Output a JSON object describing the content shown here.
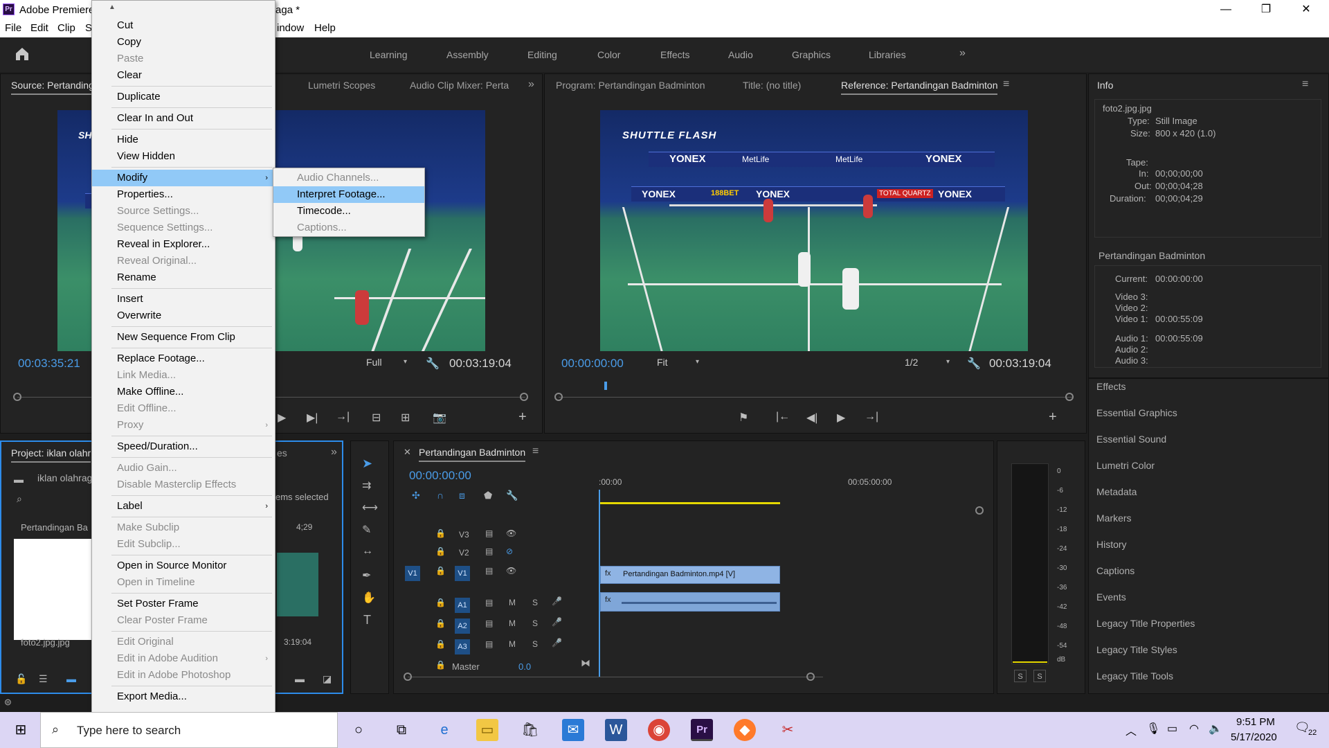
{
  "window": {
    "title_left": "Adobe Premiere",
    "title_right": "aga *",
    "minimize": "—",
    "maximize": "❐",
    "close": "✕"
  },
  "menubar": [
    "File",
    "Edit",
    "Clip",
    "S",
    "indow",
    "Help"
  ],
  "workspaces": [
    "Learning",
    "Assembly",
    "Editing",
    "Color",
    "Effects",
    "Audio",
    "Graphics",
    "Libraries"
  ],
  "source": {
    "tab": "Source: Pertanding",
    "tab2": "Lumetri Scopes",
    "tab3": "Audio Clip Mixer: Perta",
    "timecode": "00:03:35:21",
    "quality": "Full",
    "duration": "00:03:19:04",
    "overlay_label": "SH"
  },
  "program": {
    "tab": "Program: Pertandingan Badminton",
    "tab2": "Title: (no title)",
    "tab3": "Reference: Pertandingan Badminton",
    "timecode": "00:00:00:00",
    "fit": "Fit",
    "resolution": "1/2",
    "duration": "00:03:19:04",
    "overlay_label": "SHUTTLE FLASH",
    "banners": [
      "YONEX",
      "MetLife",
      "MetLife",
      "YONEX",
      "YONEX",
      "188BET",
      "YONEX",
      "TOTAL QUARTZ",
      "YONEX"
    ]
  },
  "info": {
    "tab": "Info",
    "filename": "foto2.jpg.jpg",
    "type_label": "Type:",
    "type_value": "Still Image",
    "size_label": "Size:",
    "size_value": "800 x 420 (1.0)",
    "tape_label": "Tape:",
    "in_label": "In:",
    "in_value": "00;00;00;00",
    "out_label": "Out:",
    "out_value": "00;00;04;28",
    "duration_label": "Duration:",
    "duration_value": "00;00;04;29",
    "seq_name": "Pertandingan Badminton",
    "current_label": "Current:",
    "current_value": "00:00:00:00",
    "video3": "Video 3:",
    "video2": "Video 2:",
    "video1": "Video 1:",
    "video1_value": "00:00:55:09",
    "audio1": "Audio 1:",
    "audio1_value": "00:00:55:09",
    "audio2": "Audio 2:",
    "audio3": "Audio 3:"
  },
  "right_panels": [
    "Effects",
    "Essential Graphics",
    "Essential Sound",
    "Lumetri Color",
    "Metadata",
    "Markers",
    "History",
    "Captions",
    "Events",
    "Legacy Title Properties",
    "Legacy Title Styles",
    "Legacy Title Tools"
  ],
  "project": {
    "tab": "Project: iklan olahr",
    "folder": "iklan olahrag",
    "items_selected": "ems selected",
    "item1": "Pertandingan Ba",
    "item1_dur": "4;29",
    "item2": "foto2.jpg.jpg",
    "item2_dur": "3:19:04",
    "tab_partial": "es"
  },
  "timeline": {
    "tab": "Pertandingan Badminton",
    "timecode": "00:00:00:00",
    "ruler_start": ":00:00",
    "ruler_mark": "00:05:00:00",
    "tracks_video": [
      "V3",
      "V2",
      "V1"
    ],
    "tracks_audio": [
      "A1",
      "A2",
      "A3"
    ],
    "source_patch_video": "V1",
    "master_label": "Master",
    "master_value": "0.0",
    "clip_video": "Pertandingan Badminton.mp4 [V]",
    "m": "M",
    "s": "S"
  },
  "meter": {
    "scale": [
      "0",
      "-6",
      "-12",
      "-18",
      "-24",
      "-30",
      "-36",
      "-42",
      "-48",
      "-54",
      "dB"
    ],
    "solo_left": "S",
    "solo_right": "S"
  },
  "context_menu": {
    "items": [
      {
        "label": "Cut",
        "disabled": false
      },
      {
        "label": "Copy",
        "disabled": false
      },
      {
        "label": "Paste",
        "disabled": true
      },
      {
        "label": "Clear",
        "disabled": false
      },
      {
        "label": "Duplicate",
        "disabled": false
      },
      {
        "label": "Clear In and Out",
        "disabled": false
      },
      {
        "label": "Hide",
        "disabled": false
      },
      {
        "label": "View Hidden",
        "disabled": false
      },
      {
        "label": "Modify",
        "disabled": false
      },
      {
        "label": "Properties...",
        "disabled": false
      },
      {
        "label": "Source Settings...",
        "disabled": true
      },
      {
        "label": "Sequence Settings...",
        "disabled": true
      },
      {
        "label": "Reveal in Explorer...",
        "disabled": false
      },
      {
        "label": "Reveal Original...",
        "disabled": true
      },
      {
        "label": "Rename",
        "disabled": false
      },
      {
        "label": "Insert",
        "disabled": false
      },
      {
        "label": "Overwrite",
        "disabled": false
      },
      {
        "label": "New Sequence From Clip",
        "disabled": false
      },
      {
        "label": "Replace Footage...",
        "disabled": false
      },
      {
        "label": "Link Media...",
        "disabled": true
      },
      {
        "label": "Make Offline...",
        "disabled": false
      },
      {
        "label": "Edit Offline...",
        "disabled": true
      },
      {
        "label": "Proxy",
        "disabled": true
      },
      {
        "label": "Speed/Duration...",
        "disabled": false
      },
      {
        "label": "Audio Gain...",
        "disabled": true
      },
      {
        "label": "Disable Masterclip Effects",
        "disabled": true
      },
      {
        "label": "Label",
        "disabled": false
      },
      {
        "label": "Make Subclip",
        "disabled": true
      },
      {
        "label": "Edit Subclip...",
        "disabled": true
      },
      {
        "label": "Open in Source Monitor",
        "disabled": false
      },
      {
        "label": "Open in Timeline",
        "disabled": true
      },
      {
        "label": "Set Poster Frame",
        "disabled": false
      },
      {
        "label": "Clear Poster Frame",
        "disabled": true
      },
      {
        "label": "Edit Original",
        "disabled": true
      },
      {
        "label": "Edit in Adobe Audition",
        "disabled": true
      },
      {
        "label": "Edit in Adobe Photoshop",
        "disabled": true
      },
      {
        "label": "Export Media...",
        "disabled": false
      }
    ],
    "scroll_up": "▲",
    "scroll_down": "▼"
  },
  "submenu": {
    "items": [
      {
        "label": "Audio Channels...",
        "disabled": true
      },
      {
        "label": "Interpret Footage...",
        "disabled": false
      },
      {
        "label": "Timecode...",
        "disabled": false
      },
      {
        "label": "Captions...",
        "disabled": true
      }
    ]
  },
  "taskbar": {
    "search_placeholder": "Type here to search",
    "time": "9:51 PM",
    "date": "5/17/2020",
    "notif_count": "22"
  },
  "colors": {
    "accent_blue": "#4a9ce8",
    "menu_highlight": "#91c9f7",
    "clip_blue": "#8fb4e4",
    "taskbar": "#dcd6f4"
  }
}
